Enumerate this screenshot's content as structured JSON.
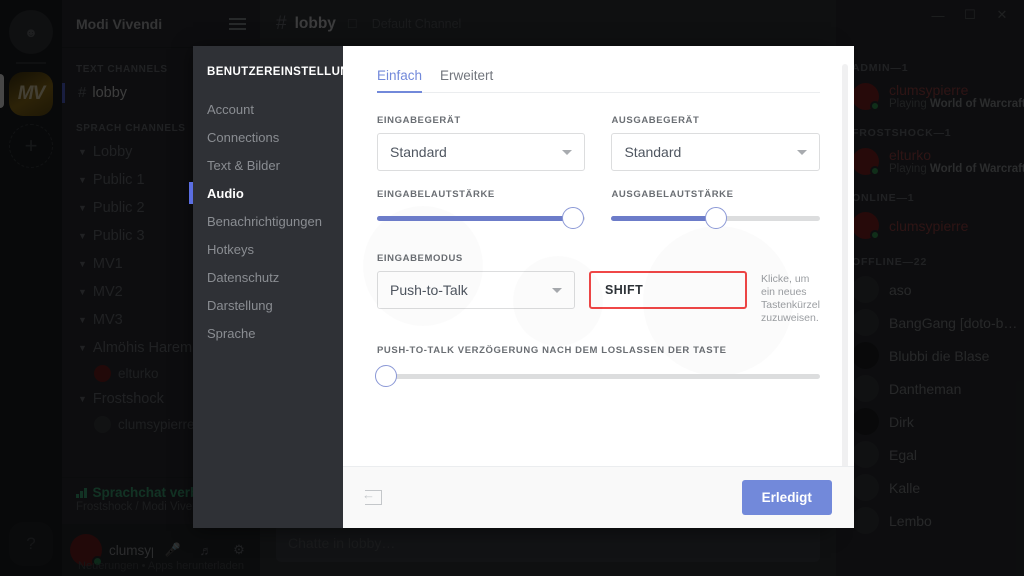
{
  "window": {
    "minimize_icon": "minimize-icon",
    "maximize_icon": "maximize-icon",
    "close_icon": "close-icon"
  },
  "guild_rail": {
    "home_icon": "home-friends-icon",
    "servers": [
      {
        "label": "MV",
        "name": "modi-vivendi"
      }
    ],
    "add_label": "+",
    "help_label": "?"
  },
  "channel_sidebar": {
    "guild_name": "Modi Vivendi",
    "menu_icon": "hamburger-icon",
    "sections": [
      {
        "title": "TEXT CHANNELS",
        "items": [
          {
            "label": "lobby",
            "prefix": "#",
            "active": true
          }
        ]
      },
      {
        "title": "SPRACH CHANNELS",
        "items": [
          {
            "label": "Lobby",
            "prefix": "v"
          },
          {
            "label": "Public 1",
            "prefix": "v"
          },
          {
            "label": "Public 2",
            "prefix": "v"
          },
          {
            "label": "Public 3",
            "prefix": "v"
          },
          {
            "label": "MV1",
            "prefix": "v"
          },
          {
            "label": "MV2",
            "prefix": "v"
          },
          {
            "label": "MV3",
            "prefix": "v"
          },
          {
            "label": "Almöhis Harem",
            "prefix": "v",
            "user": "elturko"
          },
          {
            "label": "Frostshock",
            "prefix": "v",
            "user": "clumsypierre"
          }
        ]
      }
    ],
    "voice_status": {
      "signal_icon": "signal-bars-icon",
      "title": "Sprachchat verbunden",
      "subtitle": "Frostshock / Modi Vivendi"
    },
    "user_bar": {
      "name": "clumsypier...",
      "mic_icon": "microphone-icon",
      "headset_icon": "headset-icon",
      "settings_icon": "gear-icon"
    },
    "footer": "Neuerungen  •  Apps herunterladen"
  },
  "main": {
    "channel_prefix": "#",
    "channel_name": "lobby",
    "pin_icon": "pin-icon",
    "topic": "Default Channel",
    "message_placeholder": "Chatte in lobby…"
  },
  "members": [
    {
      "group": "ADMIN—1",
      "rows": [
        {
          "name": "clumsypierre",
          "status": "online",
          "game_prefix": "Playing ",
          "game": "World of Warcraft",
          "avatar": "hat-avatar"
        }
      ]
    },
    {
      "group": "FROSTSHOCK—1",
      "rows": [
        {
          "name": "elturko",
          "status": "online",
          "game_prefix": "Playing ",
          "game": "World of Warcraft",
          "avatar": "discord-avatar"
        }
      ]
    },
    {
      "group": "ONLINE—1",
      "rows": [
        {
          "name": "clumsypierre",
          "status": "online",
          "avatar": "discord-avatar"
        }
      ]
    },
    {
      "group": "OFFLINE—22",
      "rows": [
        {
          "name": "aso",
          "status": "offline",
          "avatar": "discord-avatar"
        },
        {
          "name": "BangGang [doto-bo…",
          "status": "offline",
          "avatar": "discord-avatar"
        },
        {
          "name": "Blubbi die Blase",
          "status": "offline",
          "avatar": "photo-avatar"
        },
        {
          "name": "Dantheman",
          "status": "offline",
          "avatar": "discord-avatar"
        },
        {
          "name": "Dirk",
          "status": "offline",
          "avatar": "photo-avatar"
        },
        {
          "name": "Egal",
          "status": "offline",
          "avatar": "discord-avatar"
        },
        {
          "name": "Kalle",
          "status": "offline",
          "avatar": "discord-avatar"
        },
        {
          "name": "Lembo",
          "status": "offline",
          "avatar": "discord-avatar"
        }
      ]
    }
  ],
  "settings_modal": {
    "sidebar_title": "BENUTZEREINSTELLUNG…",
    "sidebar_items": [
      {
        "label": "Account",
        "active": false
      },
      {
        "label": "Connections",
        "active": false
      },
      {
        "label": "Text & Bilder",
        "active": false
      },
      {
        "label": "Audio",
        "active": true
      },
      {
        "label": "Benachrichtigungen",
        "active": false
      },
      {
        "label": "Hotkeys",
        "active": false
      },
      {
        "label": "Datenschutz",
        "active": false
      },
      {
        "label": "Darstellung",
        "active": false
      },
      {
        "label": "Sprache",
        "active": false
      }
    ],
    "tabs": [
      {
        "label": "Einfach",
        "active": true
      },
      {
        "label": "Erweitert",
        "active": false
      }
    ],
    "input_device": {
      "label": "EINGABEGERÄT",
      "value": "Standard"
    },
    "output_device": {
      "label": "AUSGABEGERÄT",
      "value": "Standard"
    },
    "input_volume": {
      "label": "EINGABELAUTSTÄRKE",
      "percent": 94
    },
    "output_volume": {
      "label": "AUSGABELAUTSTÄRKE",
      "percent": 50
    },
    "input_mode": {
      "label": "EINGABEMODUS",
      "value": "Push-to-Talk"
    },
    "keybind": {
      "value": "SHIFT",
      "hint": "Klicke, um ein neues Tastenkürzel zuzuweisen.",
      "border_color": "#f04747"
    },
    "ptt_delay": {
      "label": "PUSH-TO-TALK VERZÖGERUNG NACH DEM LOSLASSEN DER TASTE",
      "percent": 2
    },
    "footer": {
      "logout_icon": "logout-icon",
      "done_label": "Erledigt"
    },
    "accent_color": "#7289da",
    "slider_color": "#6c7cc9"
  }
}
